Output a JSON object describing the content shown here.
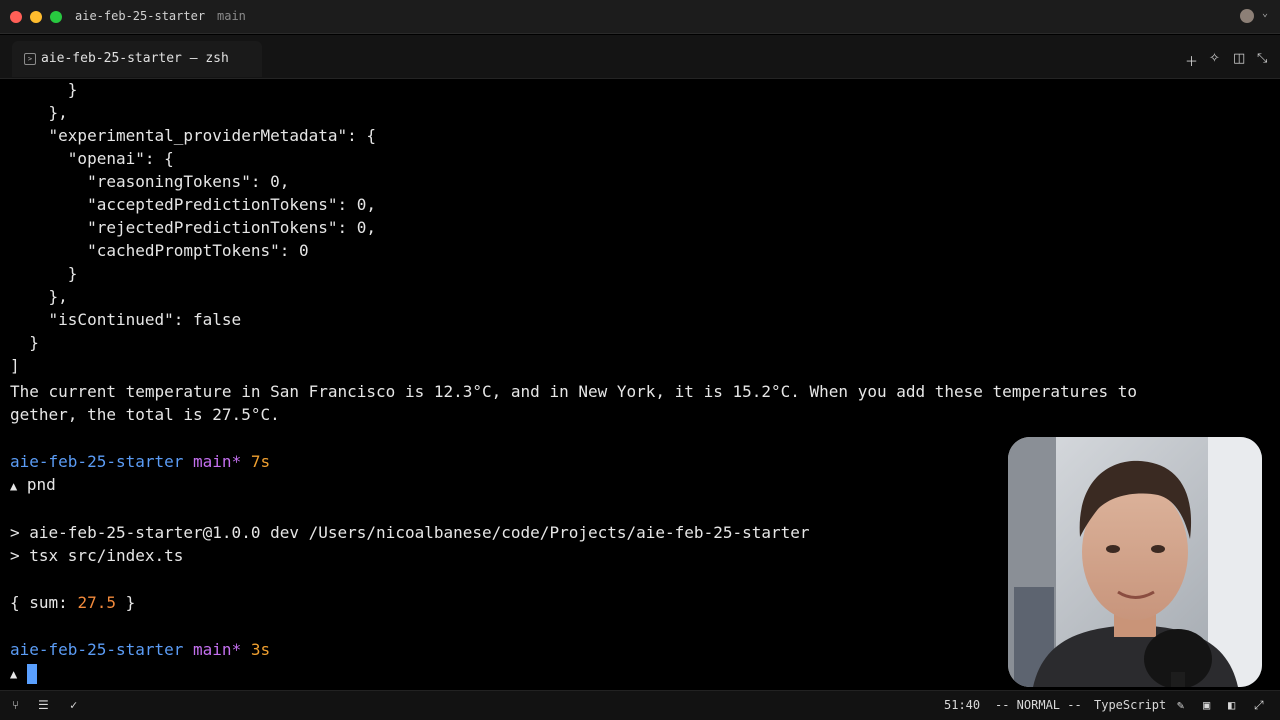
{
  "window": {
    "title": "aie-feb-25-starter",
    "branch": "main"
  },
  "tab": {
    "label": "aie-feb-25-starter — zsh",
    "icon": "terminal-icon"
  },
  "toolbar": {
    "icons": [
      "plus-icon",
      "sparkle-icon",
      "split-icon",
      "collapse-icon"
    ]
  },
  "terminal": {
    "lines": [
      "      }",
      "    },",
      "    \"experimental_providerMetadata\": {",
      "      \"openai\": {",
      "        \"reasoningTokens\": 0,",
      "        \"acceptedPredictionTokens\": 0,",
      "        \"rejectedPredictionTokens\": 0,",
      "        \"cachedPromptTokens\": 0",
      "      }",
      "    },",
      "    \"isContinued\": false",
      "  }",
      "]",
      "The current temperature in San Francisco is 12.3°C, and in New York, it is 15.2°C. When you add these temperatures to",
      "gether, the total is 27.5°C."
    ],
    "prompt1": {
      "dir": "aie-feb-25-starter",
      "branch": "main*",
      "time": "7s",
      "symbol": "▲",
      "command": "pnd"
    },
    "npm_lines": [
      "> aie-feb-25-starter@1.0.0 dev /Users/nicoalbanese/code/Projects/aie-feb-25-starter",
      "> tsx src/index.ts"
    ],
    "output": {
      "open": "{ sum: ",
      "value": "27.5",
      "close": " }"
    },
    "prompt2": {
      "dir": "aie-feb-25-starter",
      "branch": "main*",
      "time": "3s",
      "symbol": "▲"
    }
  },
  "statusbar": {
    "position": "51:40",
    "mode": "-- NORMAL --",
    "language": "TypeScript"
  }
}
